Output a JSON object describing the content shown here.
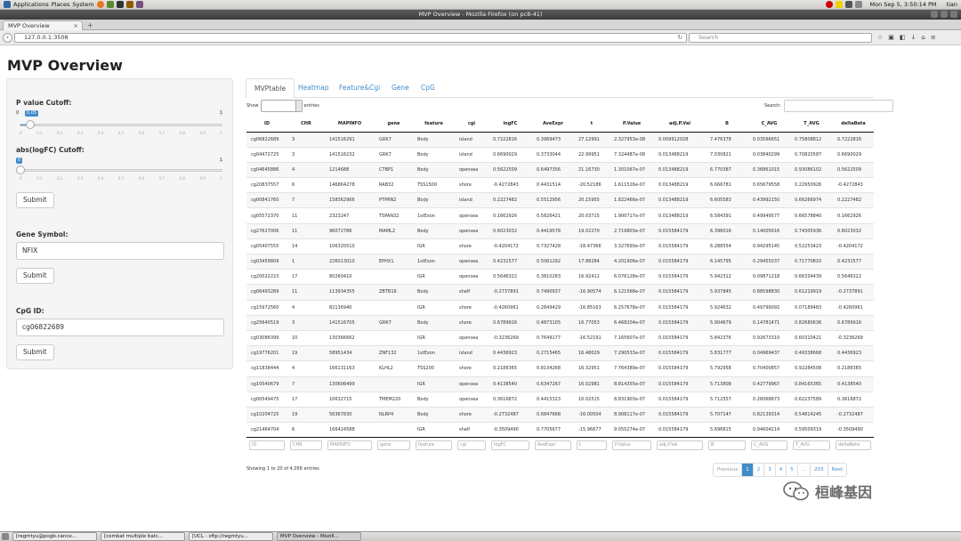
{
  "system_panel": {
    "menus": [
      "Applications",
      "Places",
      "System"
    ],
    "clock": "Mon Sep  5,  3:50:14 PM",
    "user": "tian"
  },
  "window": {
    "title": "MVP Overview - Mozilla Firefox (on pc8-41)"
  },
  "browser": {
    "tab_title": "MVP Overview",
    "url": "127.0.0.1:3508",
    "search_placeholder": "Search"
  },
  "app": {
    "title": "MVP Overview"
  },
  "sidebar": {
    "pvalue_label": "P value Cutoff:",
    "pvalue_value": "0.05",
    "pvalue_max": "1",
    "pvalue_min": "0",
    "pvalue_level": 0.05,
    "logfc_label": "abs(logFC) Cutoff:",
    "logfc_value": "0",
    "logfc_max": "1",
    "logfc_level": 0,
    "slider_ticks": [
      "0",
      "0.1",
      "0.2",
      "0.3",
      "0.4",
      "0.5",
      "0.6",
      "0.7",
      "0.8",
      "0.9",
      "1"
    ],
    "submit_label": "Submit",
    "gene_label": "Gene Symbol:",
    "gene_value": "NFIX",
    "cpg_label": "CpG ID:",
    "cpg_value": "cg06822689"
  },
  "tabs": [
    "MVPtable",
    "Heatmap",
    "Feature&Cgi",
    "Gene",
    "CpG"
  ],
  "table_controls": {
    "show_label": "Show",
    "entries_label": "entries",
    "search_label": "Search:"
  },
  "table": {
    "columns": [
      "ID",
      "CHR",
      "MAPINFO",
      "gene",
      "feature",
      "cgi",
      "logFC",
      "AveExpr",
      "t",
      "P.Value",
      "adj.P.Val",
      "B",
      "C_AVG",
      "T_AVG",
      "deltaBeta"
    ],
    "rows": [
      [
        "cg06822689",
        "3",
        "141516291",
        "GRK7",
        "Body",
        "island",
        "0.7222816",
        "0.3969473",
        "27.12991",
        "2.327953e-08",
        "0.009912028",
        "7.476378",
        "0.03566651",
        "0.75808812",
        "0.7222816"
      ],
      [
        "cg04472725",
        "3",
        "141516232",
        "GRK7",
        "Body",
        "island",
        "0.6690029",
        "0.3733044",
        "22.99951",
        "7.324487e-08",
        "0.013488219",
        "7.030821",
        "0.03840299",
        "0.70820587",
        "0.6690029"
      ],
      [
        "cg04645886",
        "4",
        "1214688",
        "CTBP1",
        "Body",
        "opensea",
        "0.5622509",
        "0.6497356",
        "21.16730",
        "1.301067e-07",
        "0.013488219",
        "6.770387",
        "0.36861015",
        "0.93086102",
        "0.5622509"
      ],
      [
        "cg20837557",
        "6",
        "146864278",
        "RAB32",
        "TSS1500",
        "shore",
        "-0.4272843",
        "0.4431514",
        "-20.52186",
        "1.611526e-07",
        "0.013488219",
        "6.666781",
        "0.65679558",
        "0.22950926",
        "-0.4272843"
      ],
      [
        "cg00841760",
        "7",
        "158362966",
        "PTPRN2",
        "Body",
        "island",
        "0.2227482",
        "0.5512956",
        "20.15955",
        "1.822466e-07",
        "0.013488219",
        "6.605583",
        "0.43992150",
        "0.66266974",
        "0.2227482"
      ],
      [
        "cg05572370",
        "11",
        "2323247",
        "TSPAN32",
        "1stExon",
        "opensea",
        "0.1662926",
        "0.5826421",
        "20.03715",
        "1.900717e-07",
        "0.013488219",
        "6.584391",
        "0.49949577",
        "0.66578840",
        "0.1662926"
      ],
      [
        "cg27627006",
        "11",
        "96072786",
        "MAML2",
        "Body",
        "opensea",
        "0.6023032",
        "0.4419578",
        "19.02270",
        "2.719803e-07",
        "0.015584179",
        "6.398016",
        "0.14005616",
        "0.74305936",
        "0.6023032"
      ],
      [
        "cg05407555",
        "14",
        "106320510",
        "",
        "IGR",
        "shore",
        "-0.4204172",
        "0.7327428",
        "-18.47366",
        "3.327690e-07",
        "0.015584179",
        "6.288554",
        "0.94295145",
        "0.52253423",
        "-0.4204172"
      ],
      [
        "cg03459809",
        "1",
        "226013010",
        "EPHX1",
        "1stExon",
        "opensea",
        "0.4231577",
        "0.5061292",
        "17.88284",
        "4.201906e-07",
        "0.015584179",
        "6.145795",
        "0.29455037",
        "0.71770810",
        "0.4231577"
      ],
      [
        "cg20022223",
        "17",
        "80260410",
        "",
        "IGR",
        "opensea",
        "0.5646322",
        "0.3810283",
        "16.92411",
        "6.076128e-07",
        "0.015584179",
        "5.942312",
        "0.09871218",
        "0.66334439",
        "0.5646322"
      ],
      [
        "cg06493289",
        "11",
        "113934355",
        "ZBTB16",
        "Body",
        "shelf",
        "-0.2737891",
        "0.7490937",
        "-16.90574",
        "6.121568e-07",
        "0.015584179",
        "5.937845",
        "0.88598830",
        "0.61219919",
        "-0.2737891"
      ],
      [
        "cg15972560",
        "4",
        "82136940",
        "",
        "IGR",
        "shore",
        "-0.4260961",
        "0.2849429",
        "-16.85163",
        "6.257678e-07",
        "0.015584179",
        "5.924632",
        "0.49799092",
        "0.07189483",
        "-0.4260961"
      ],
      [
        "cg25640519",
        "3",
        "141516705",
        "GRK7",
        "Body",
        "shore",
        "0.6789916",
        "0.4873105",
        "16.77053",
        "6.468204e-07",
        "0.015584179",
        "5.904679",
        "0.14781471",
        "0.82680636",
        "0.6789916"
      ],
      [
        "cg03086399",
        "10",
        "130366662",
        "",
        "IGR",
        "opensea",
        "-0.3236269",
        "0.7649177",
        "-16.52191",
        "7.165607e-07",
        "0.015584179",
        "5.842376",
        "0.92673310",
        "0.60310421",
        "-0.3236269"
      ],
      [
        "cg19776201",
        "19",
        "58951434",
        "ZNF132",
        "1stExon",
        "island",
        "0.4436923",
        "0.2715465",
        "16.48029",
        "7.290533e-07",
        "0.015584179",
        "5.831777",
        "0.04969437",
        "0.49338668",
        "0.4436923"
      ],
      [
        "cg11838444",
        "4",
        "166131163",
        "KLHL2",
        "TSS200",
        "shore",
        "0.2188365",
        "0.8134268",
        "16.32951",
        "7.764389e-07",
        "0.015584179",
        "5.792958",
        "0.70400857",
        "0.92284508",
        "0.2188365"
      ],
      [
        "cg10540679",
        "7",
        "130606499",
        "",
        "IGR",
        "opensea",
        "0.4138540",
        "0.6347267",
        "16.02981",
        "8.814355e-07",
        "0.015584179",
        "5.713808",
        "0.42779967",
        "0.84165365",
        "0.4138540"
      ],
      [
        "cg00549475",
        "17",
        "10632715",
        "TMEM220",
        "Body",
        "opensea",
        "0.3616872",
        "0.4415323",
        "16.02515",
        "8.831903e-07",
        "0.015584179",
        "5.712557",
        "0.26068873",
        "0.62237589",
        "0.3616872"
      ],
      [
        "cg10204725",
        "19",
        "56367830",
        "NLRP4",
        "Body",
        "shore",
        "-0.2732487",
        "0.6847668",
        "-16.00504",
        "8.908117e-07",
        "0.015584179",
        "5.707147",
        "0.82139314",
        "0.54814245",
        "-0.2732487"
      ],
      [
        "cg21464704",
        "6",
        "166424588",
        "",
        "IGR",
        "shelf",
        "-0.3509490",
        "0.7705677",
        "-15.96677",
        "9.055274e-07",
        "0.015584179",
        "5.696815",
        "0.94604214",
        "0.59509319",
        "-0.3509490"
      ]
    ]
  },
  "table_footer": {
    "info": "Showing 1 to 20 of 4,058 entries",
    "pagination": {
      "previous": "Previous",
      "pages": [
        "1",
        "2",
        "3",
        "4",
        "5",
        "...",
        "203"
      ],
      "next": "Next",
      "current": "1"
    }
  },
  "watermark": {
    "text": "桓峰基因"
  },
  "taskbar": {
    "items": [
      "[regmtyu@pogb.cance...",
      "[combat multiple batc...",
      "[UCL - sftp://regmtyu...",
      "MVP Overview - Mozill..."
    ],
    "active": 3
  }
}
